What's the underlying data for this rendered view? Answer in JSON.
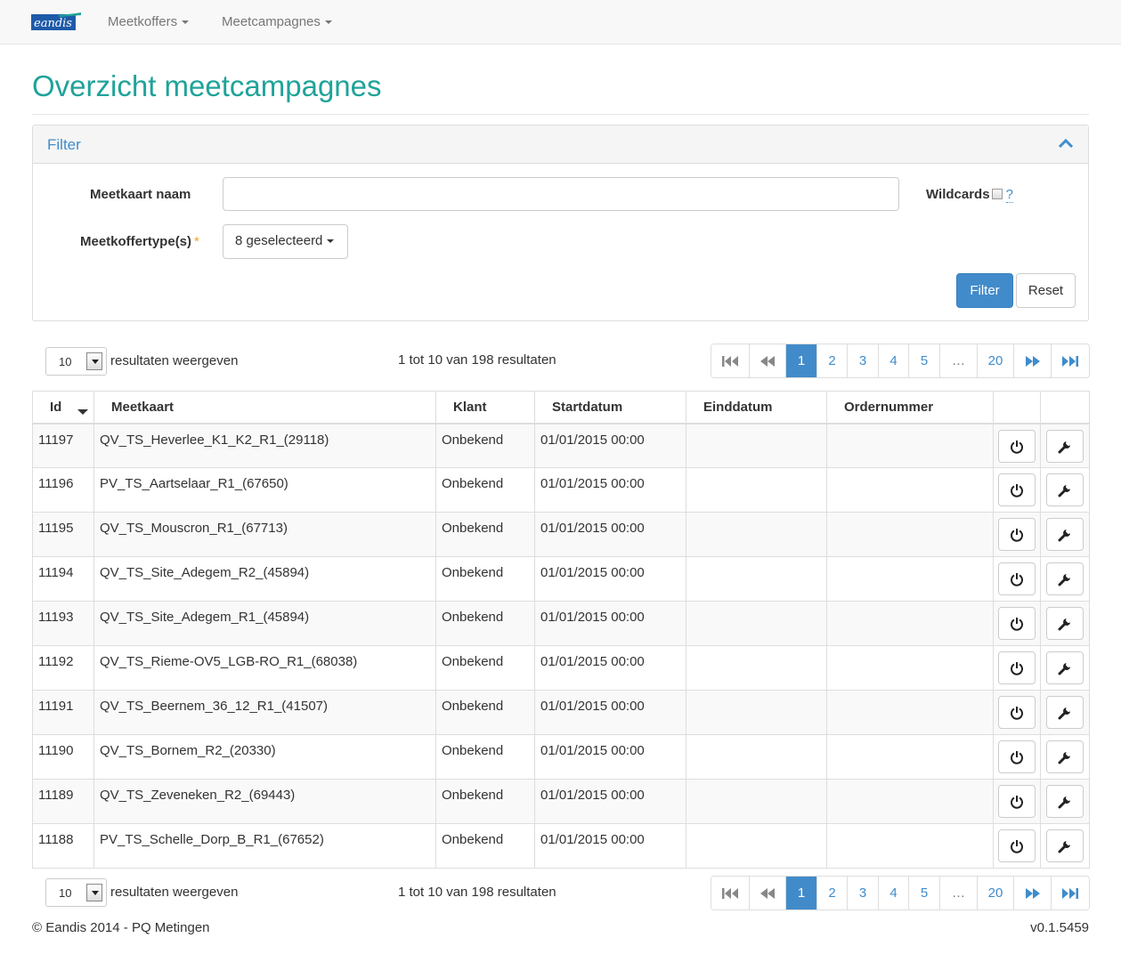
{
  "navbar": {
    "brand": "eandis",
    "menu": [
      {
        "label": "Meetkoffers"
      },
      {
        "label": "Meetcampagnes"
      }
    ]
  },
  "page_title": "Overzicht meetcampagnes",
  "filter": {
    "title": "Filter",
    "name_label": "Meetkaart naam",
    "name_value": "",
    "wildcards_label": "Wildcards",
    "wildcards_help": "?",
    "type_label": "Meetkoffertype(s)",
    "required_mark": "*",
    "type_value": "8 geselecteerd",
    "filter_button": "Filter",
    "reset_button": "Reset"
  },
  "paging": {
    "length": "10",
    "length_text": "resultaten weergeven",
    "info": "1 tot 10 van 198 resultaten",
    "pages": [
      "1",
      "2",
      "3",
      "4",
      "5",
      "…",
      "20"
    ],
    "active_page": "1"
  },
  "table": {
    "headers": {
      "id": "Id",
      "meetkaart": "Meetkaart",
      "klant": "Klant",
      "startdatum": "Startdatum",
      "einddatum": "Einddatum",
      "ordernummer": "Ordernummer"
    },
    "rows": [
      {
        "id": "11197",
        "meetkaart": "QV_TS_Heverlee_K1_K2_R1_(29118)",
        "klant": "Onbekend",
        "startdatum": "01/01/2015 00:00",
        "einddatum": "",
        "ordernummer": ""
      },
      {
        "id": "11196",
        "meetkaart": "PV_TS_Aartselaar_R1_(67650)",
        "klant": "Onbekend",
        "startdatum": "01/01/2015 00:00",
        "einddatum": "",
        "ordernummer": ""
      },
      {
        "id": "11195",
        "meetkaart": "QV_TS_Mouscron_R1_(67713)",
        "klant": "Onbekend",
        "startdatum": "01/01/2015 00:00",
        "einddatum": "",
        "ordernummer": ""
      },
      {
        "id": "11194",
        "meetkaart": "QV_TS_Site_Adegem_R2_(45894)",
        "klant": "Onbekend",
        "startdatum": "01/01/2015 00:00",
        "einddatum": "",
        "ordernummer": ""
      },
      {
        "id": "11193",
        "meetkaart": "QV_TS_Site_Adegem_R1_(45894)",
        "klant": "Onbekend",
        "startdatum": "01/01/2015 00:00",
        "einddatum": "",
        "ordernummer": ""
      },
      {
        "id": "11192",
        "meetkaart": "QV_TS_Rieme-OV5_LGB-RO_R1_(68038)",
        "klant": "Onbekend",
        "startdatum": "01/01/2015 00:00",
        "einddatum": "",
        "ordernummer": ""
      },
      {
        "id": "11191",
        "meetkaart": "QV_TS_Beernem_36_12_R1_(41507)",
        "klant": "Onbekend",
        "startdatum": "01/01/2015 00:00",
        "einddatum": "",
        "ordernummer": ""
      },
      {
        "id": "11190",
        "meetkaart": "QV_TS_Bornem_R2_(20330)",
        "klant": "Onbekend",
        "startdatum": "01/01/2015 00:00",
        "einddatum": "",
        "ordernummer": ""
      },
      {
        "id": "11189",
        "meetkaart": "QV_TS_Zeveneken_R2_(69443)",
        "klant": "Onbekend",
        "startdatum": "01/01/2015 00:00",
        "einddatum": "",
        "ordernummer": ""
      },
      {
        "id": "11188",
        "meetkaart": "PV_TS_Schelle_Dorp_B_R1_(67652)",
        "klant": "Onbekend",
        "startdatum": "01/01/2015 00:00",
        "einddatum": "",
        "ordernummer": ""
      }
    ]
  },
  "footer": {
    "copyright": "© Eandis 2014 - PQ Metingen",
    "version": "v0.1.5459"
  },
  "colors": {
    "title": "#1fa39a",
    "link": "#3f8ccb",
    "primary": "#428bca"
  },
  "icons": [
    "eandis-logo-icon",
    "chevron-up-icon",
    "first-page-icon",
    "previous-page-icon",
    "next-page-icon",
    "last-page-icon",
    "power-icon",
    "wrench-icon",
    "sort-desc-icon"
  ]
}
